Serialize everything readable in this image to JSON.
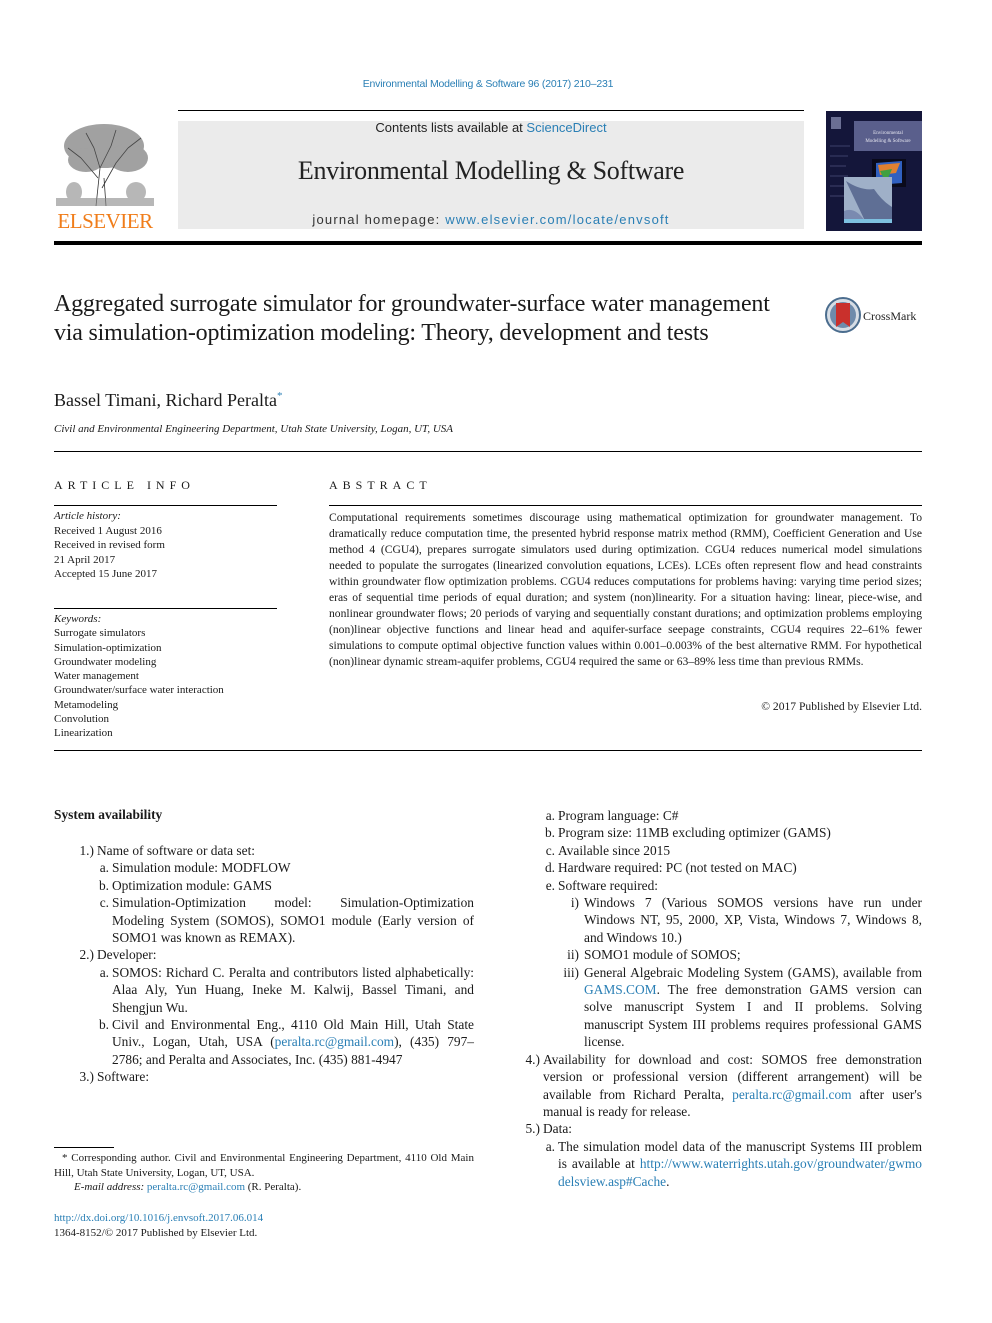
{
  "running_head": "Environmental Modelling & Software 96 (2017) 210–231",
  "masthead": {
    "publisher_logo_text": "ELSEVIER",
    "contents_prefix": "Contents lists available at ",
    "contents_link": "ScienceDirect",
    "journal_title": "Environmental Modelling & Software",
    "homepage_prefix": "journal homepage: ",
    "homepage_link": "www.elsevier.com/locate/envsoft",
    "cover_title": "Environmental Modelling & Software",
    "colors": {
      "link": "#2a7fb5",
      "elsevier_orange": "#f07d1a",
      "masthead_gray": "#ebebeb",
      "cover_navy": "#14163a"
    }
  },
  "article": {
    "title": "Aggregated surrogate simulator for groundwater-surface water management via simulation-optimization modeling: Theory, development and tests",
    "crossmark_label": "CrossMark",
    "authors": "Bassel Timani, Richard Peralta",
    "corresponding_mark": "*",
    "affiliation": "Civil and Environmental Engineering Department, Utah State University, Logan, UT, USA"
  },
  "article_info": {
    "heading": "ARTICLE INFO",
    "history_label": "Article history:",
    "history": [
      "Received 1 August 2016",
      "Received in revised form",
      "21 April 2017",
      "Accepted 15 June 2017"
    ],
    "keywords_label": "Keywords:",
    "keywords": [
      "Surrogate simulators",
      "Simulation-optimization",
      "Groundwater modeling",
      "Water management",
      "Groundwater/surface water interaction",
      "Metamodeling",
      "Convolution",
      "Linearization"
    ]
  },
  "abstract": {
    "heading": "ABSTRACT",
    "text": "Computational requirements sometimes discourage using mathematical optimization for groundwater management. To dramatically reduce computation time, the presented hybrid response matrix method (RMM), Coefficient Generation and Use method 4 (CGU4), prepares surrogate simulators used during optimization. CGU4 reduces numerical model simulations needed to populate the surrogates (linearized convolution equations, LCEs). LCEs often represent flow and head constraints within groundwater flow optimization problems. CGU4 reduces computations for problems having: varying time period sizes; eras of sequential time periods of equal duration; and system (non)linearity. For a situation having: linear, piece-wise, and nonlinear groundwater flows; 20 periods of varying and sequentially constant durations; and optimization problems employing (non)linear objective functions and linear head and aquifer-surface seepage constraints, CGU4 requires 22–61% fewer simulations to compute optimal objective function values within 0.001–0.003% of the best alternative RMM. For hypothetical (non)linear dynamic stream-aquifer problems, CGU4 required the same or 63–89% less time than previous RMMs.",
    "copyright": "© 2017 Published by Elsevier Ltd."
  },
  "system_availability": {
    "heading": "System availability",
    "left": [
      {
        "level": 1,
        "label": "1.)",
        "text": "Name of software or data set:"
      },
      {
        "level": 2,
        "label": "a.",
        "text": "Simulation module: MODFLOW"
      },
      {
        "level": 2,
        "label": "b.",
        "text": "Optimization module: GAMS"
      },
      {
        "level": 2,
        "label": "c.",
        "text": "Simulation-Optimization model: Simulation-Optimization Modeling System (SOMOS), SOMO1 module (Early version of SOMO1 was known as REMAX)."
      },
      {
        "level": 1,
        "label": "2.)",
        "text": "Developer:"
      },
      {
        "level": 2,
        "label": "a.",
        "text": "SOMOS: Richard C. Peralta and contributors listed alphabetically: Alaa Aly, Yun Huang, Ineke M. Kalwij, Bassel Timani, and Shengjun Wu."
      },
      {
        "level": 2,
        "label": "b.",
        "pre": "Civil and Environmental Eng., 4110 Old Main Hill, Utah State Univ., Logan, Utah, USA (",
        "link": "peralta.rc@gmail.com",
        "post": "), (435) 797–2786; and Peralta and Associates, Inc. (435) 881-4947"
      },
      {
        "level": 1,
        "label": "3.)",
        "text": "Software:"
      }
    ],
    "right": [
      {
        "level": 2,
        "label": "a.",
        "text": "Program language: C#"
      },
      {
        "level": 2,
        "label": "b.",
        "text": "Program size: 11MB excluding optimizer (GAMS)"
      },
      {
        "level": 2,
        "label": "c.",
        "text": "Available since 2015"
      },
      {
        "level": 2,
        "label": "d.",
        "text": "Hardware required: PC (not tested on MAC)"
      },
      {
        "level": 2,
        "label": "e.",
        "text": "Software required:"
      },
      {
        "level": 3,
        "label": "i)",
        "text": "Windows 7 (Various SOMOS versions have run under Windows NT, 95, 2000, XP, Vista, Windows 7, Windows 8, and Windows 10.)"
      },
      {
        "level": 3,
        "label": "ii)",
        "text": "SOMO1 module of SOMOS;"
      },
      {
        "level": 3,
        "label": "iii)",
        "pre": "General Algebraic Modeling System (GAMS), available from ",
        "link": "GAMS.COM",
        "post": ". The free demonstration GAMS version can solve manuscript System I and II problems. Solving manuscript System III problems requires professional GAMS license."
      },
      {
        "level": 1,
        "label": "4.)",
        "pre": "Availability for download and cost: SOMOS free demonstration version or professional version (different arrangement) will be available from Richard Peralta, ",
        "link": "peralta.rc@gmail.com",
        "post": " after user's manual is ready for release."
      },
      {
        "level": 1,
        "label": "5.)",
        "text": "Data:"
      },
      {
        "level": 2,
        "label": "a.",
        "pre": "The simulation model data of the manuscript Systems III problem is available at ",
        "link": "http://www.waterrights.utah.gov/groundwater/gwmodelsview.asp#Cache",
        "post": "."
      }
    ]
  },
  "footnote": {
    "corresponding": "* Corresponding author. Civil and Environmental Engineering Department, 4110 Old Main Hill, Utah State University, Logan, UT, USA.",
    "email_label": "E-mail address: ",
    "email": "peralta.rc@gmail.com",
    "email_suffix": " (R. Peralta).",
    "doi": "http://dx.doi.org/10.1016/j.envsoft.2017.06.014",
    "issn": "1364-8152/© 2017 Published by Elsevier Ltd."
  }
}
